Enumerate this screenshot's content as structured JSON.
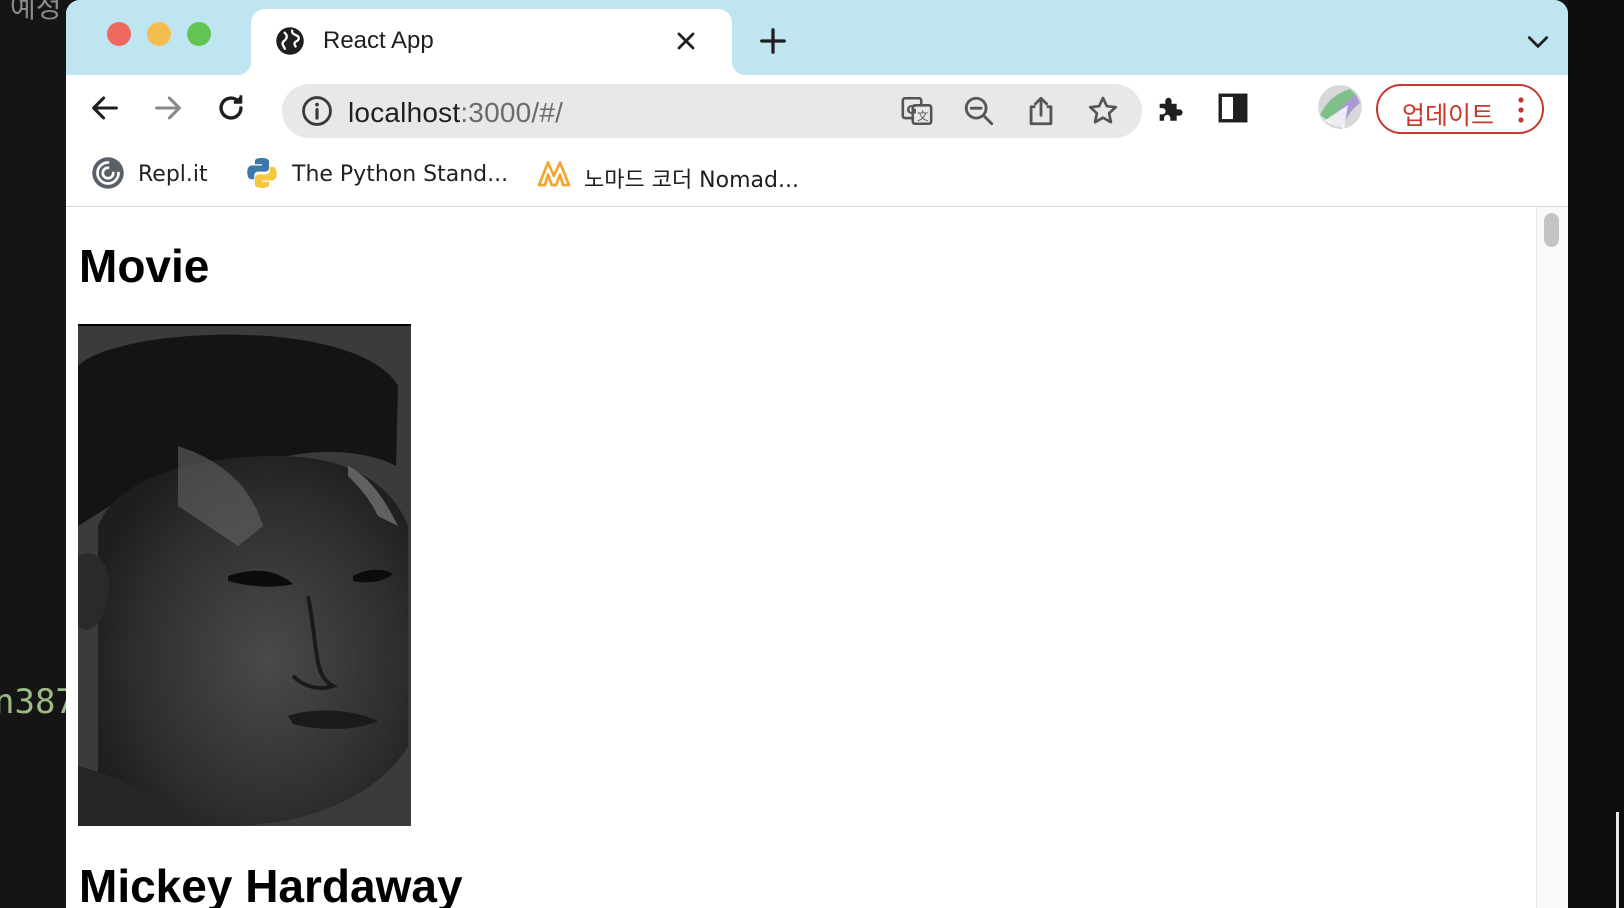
{
  "background": {
    "top_text": "예정",
    "mid_text": "n387"
  },
  "browser": {
    "tab": {
      "title": "React App",
      "favicon": "globe-icon"
    },
    "toolbar": {
      "url_host": "localhost",
      "url_path": ":3000/#/",
      "icons": [
        "back-arrow-icon",
        "forward-arrow-icon",
        "reload-icon",
        "info-icon",
        "translate-icon",
        "zoom-out-icon",
        "share-icon",
        "bookmark-star-icon",
        "extensions-icon",
        "side-panel-icon",
        "avatar",
        "more-vert-icon"
      ],
      "update_label": "업데이트",
      "accent_color": "#c5382c"
    },
    "bookmarks": [
      {
        "label": "Repl.it",
        "icon": "replit-icon"
      },
      {
        "label": "The Python Stand...",
        "icon": "python-icon"
      },
      {
        "label": "노마드 코더 Nomad...",
        "icon": "nomad-coders-icon"
      }
    ]
  },
  "page": {
    "title": "Movie",
    "movie_name": "Mickey Hardaway"
  }
}
